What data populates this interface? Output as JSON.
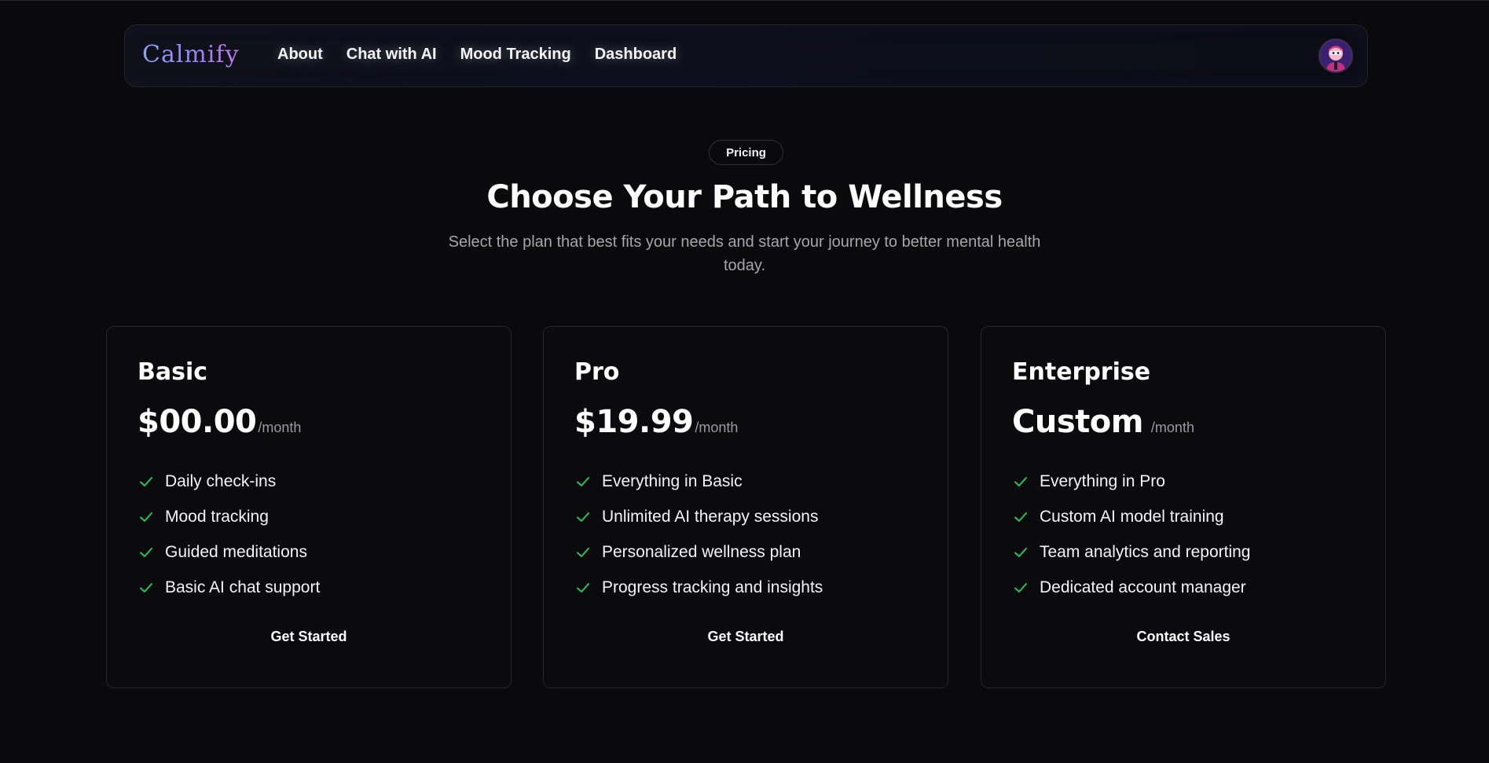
{
  "brand": {
    "name": "Calmify"
  },
  "nav": {
    "links": [
      "About",
      "Chat with AI",
      "Mood Tracking",
      "Dashboard"
    ]
  },
  "hero": {
    "badge": "Pricing",
    "title": "Choose Your Path to Wellness",
    "subtitle": "Select the plan that best fits your needs and start your journey to better mental health today."
  },
  "colors": {
    "accent_check": "#22c55e",
    "background": "#0a0a0c",
    "logo_gradient_start": "#8aa4f5",
    "logo_gradient_end": "#c27ae8"
  },
  "icons": {
    "feature": "check-icon",
    "avatar": "user-avatar"
  },
  "plans": [
    {
      "name": "Basic",
      "price": "$00.00",
      "period": "/month",
      "features": [
        "Daily check-ins",
        "Mood tracking",
        "Guided meditations",
        "Basic AI chat support"
      ],
      "cta": "Get Started"
    },
    {
      "name": "Pro",
      "price": "$19.99",
      "period": "/month",
      "features": [
        "Everything in Basic",
        "Unlimited AI therapy sessions",
        "Personalized wellness plan",
        "Progress tracking and insights"
      ],
      "cta": "Get Started"
    },
    {
      "name": "Enterprise",
      "price": "Custom",
      "period": "/month",
      "features": [
        "Everything in Pro",
        "Custom AI model training",
        "Team analytics and reporting",
        "Dedicated account manager"
      ],
      "cta": "Contact Sales"
    }
  ]
}
